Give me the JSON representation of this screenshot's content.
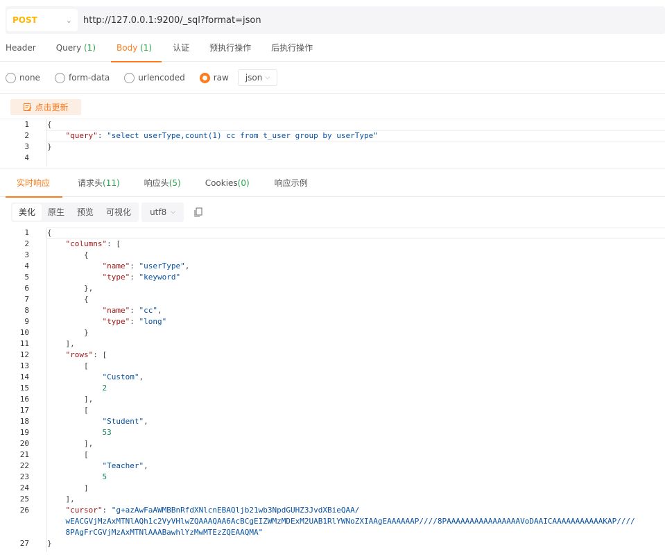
{
  "request": {
    "method": "POST",
    "url": "http://127.0.0.1:9200/_sql?format=json"
  },
  "request_tabs": [
    {
      "label": "Header",
      "count": ""
    },
    {
      "label": "Query ",
      "count": "(1)"
    },
    {
      "label": "Body ",
      "count": "(1)"
    },
    {
      "label": "认证",
      "count": ""
    },
    {
      "label": "预执行操作",
      "count": ""
    },
    {
      "label": "后执行操作",
      "count": ""
    }
  ],
  "body_types": {
    "none": "none",
    "form_data": "form-data",
    "urlencoded": "urlencoded",
    "raw": "raw",
    "format": "json"
  },
  "update_button": "点击更新",
  "request_body": {
    "ln": [
      "1",
      "2",
      "3",
      "4"
    ],
    "line1": "{",
    "key": "\"query\"",
    "colon": ": ",
    "value": "\"select userType,count(1) cc from t_user group by userType\"",
    "line3": "}"
  },
  "response_tabs": [
    {
      "label": "实时响应",
      "count": ""
    },
    {
      "label": "请求头",
      "count": "(11)"
    },
    {
      "label": "响应头",
      "count": "(5)"
    },
    {
      "label": "Cookies",
      "count": "(0)"
    },
    {
      "label": "响应示例",
      "count": ""
    }
  ],
  "view_modes": [
    "美化",
    "原生",
    "预览",
    "可视化"
  ],
  "encoding": "utf8",
  "response_lines": [
    {
      "n": "1",
      "parts": [
        [
          "p",
          "{"
        ]
      ]
    },
    {
      "n": "2",
      "parts": [
        [
          "p",
          "    "
        ],
        [
          "k",
          "\"columns\""
        ],
        [
          "p",
          ": ["
        ]
      ]
    },
    {
      "n": "3",
      "parts": [
        [
          "p",
          "        {"
        ]
      ]
    },
    {
      "n": "4",
      "parts": [
        [
          "p",
          "            "
        ],
        [
          "k",
          "\"name\""
        ],
        [
          "p",
          ": "
        ],
        [
          "s",
          "\"userType\""
        ],
        [
          "p",
          ","
        ]
      ]
    },
    {
      "n": "5",
      "parts": [
        [
          "p",
          "            "
        ],
        [
          "k",
          "\"type\""
        ],
        [
          "p",
          ": "
        ],
        [
          "s",
          "\"keyword\""
        ]
      ]
    },
    {
      "n": "6",
      "parts": [
        [
          "p",
          "        },"
        ]
      ]
    },
    {
      "n": "7",
      "parts": [
        [
          "p",
          "        {"
        ]
      ]
    },
    {
      "n": "8",
      "parts": [
        [
          "p",
          "            "
        ],
        [
          "k",
          "\"name\""
        ],
        [
          "p",
          ": "
        ],
        [
          "s",
          "\"cc\""
        ],
        [
          "p",
          ","
        ]
      ]
    },
    {
      "n": "9",
      "parts": [
        [
          "p",
          "            "
        ],
        [
          "k",
          "\"type\""
        ],
        [
          "p",
          ": "
        ],
        [
          "s",
          "\"long\""
        ]
      ]
    },
    {
      "n": "10",
      "parts": [
        [
          "p",
          "        }"
        ]
      ]
    },
    {
      "n": "11",
      "parts": [
        [
          "p",
          "    ],"
        ]
      ]
    },
    {
      "n": "12",
      "parts": [
        [
          "p",
          "    "
        ],
        [
          "k",
          "\"rows\""
        ],
        [
          "p",
          ": ["
        ]
      ]
    },
    {
      "n": "13",
      "parts": [
        [
          "p",
          "        ["
        ]
      ]
    },
    {
      "n": "14",
      "parts": [
        [
          "p",
          "            "
        ],
        [
          "s",
          "\"Custom\""
        ],
        [
          "p",
          ","
        ]
      ]
    },
    {
      "n": "15",
      "parts": [
        [
          "p",
          "            "
        ],
        [
          "n",
          "2"
        ]
      ]
    },
    {
      "n": "16",
      "parts": [
        [
          "p",
          "        ],"
        ]
      ]
    },
    {
      "n": "17",
      "parts": [
        [
          "p",
          "        ["
        ]
      ]
    },
    {
      "n": "18",
      "parts": [
        [
          "p",
          "            "
        ],
        [
          "s",
          "\"Student\""
        ],
        [
          "p",
          ","
        ]
      ]
    },
    {
      "n": "19",
      "parts": [
        [
          "p",
          "            "
        ],
        [
          "n",
          "53"
        ]
      ]
    },
    {
      "n": "20",
      "parts": [
        [
          "p",
          "        ],"
        ]
      ]
    },
    {
      "n": "21",
      "parts": [
        [
          "p",
          "        ["
        ]
      ]
    },
    {
      "n": "22",
      "parts": [
        [
          "p",
          "            "
        ],
        [
          "s",
          "\"Teacher\""
        ],
        [
          "p",
          ","
        ]
      ]
    },
    {
      "n": "23",
      "parts": [
        [
          "p",
          "            "
        ],
        [
          "n",
          "5"
        ]
      ]
    },
    {
      "n": "24",
      "parts": [
        [
          "p",
          "        ]"
        ]
      ]
    },
    {
      "n": "25",
      "parts": [
        [
          "p",
          "    ],"
        ]
      ]
    },
    {
      "n": "26",
      "parts": [
        [
          "p",
          "    "
        ],
        [
          "k",
          "\"cursor\""
        ],
        [
          "p",
          ": "
        ],
        [
          "s",
          "\"g+azAwFaAWMBBnRfdXNlcnEBAQljb21wb3NpdGUHZ3JvdXBieQAA/"
        ]
      ]
    },
    {
      "n": "",
      "parts": [
        [
          "s",
          "    wEACGVjMzAxMTNlAQh1c2VyVHlwZQAAAQAA6AcBCgEIZWMzMDExM2UAB1RlYWNoZXIAAgEAAAAAAP////8PAAAAAAAAAAAAAAAAVoDAAICAAAAAAAAAAAKAP////"
        ]
      ]
    },
    {
      "n": "",
      "parts": [
        [
          "s",
          "    8PAgFrCGVjMzAxMTNlAAABawhlYzMwMTEzZQEAAQMA\""
        ]
      ]
    },
    {
      "n": "27",
      "parts": [
        [
          "p",
          "}"
        ]
      ]
    }
  ]
}
